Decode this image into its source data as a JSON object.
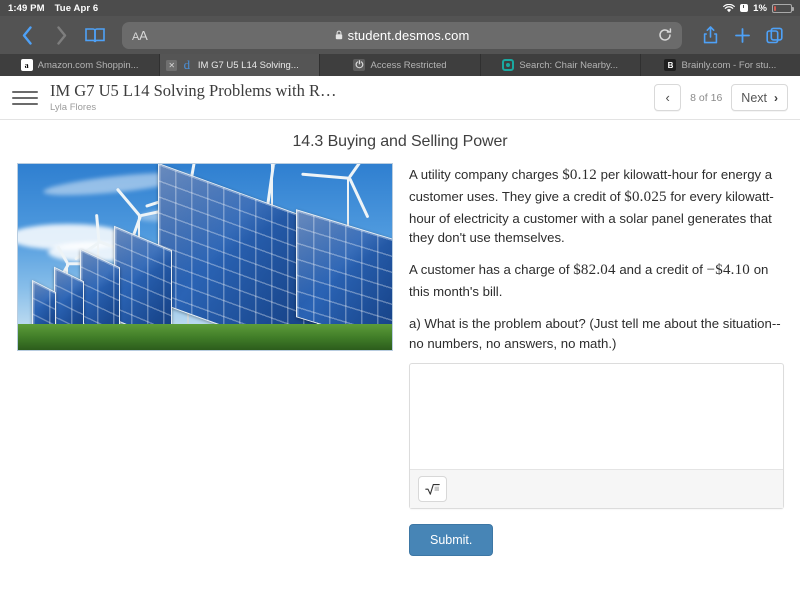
{
  "status_bar": {
    "time": "1:49 PM",
    "date": "Tue Apr 6",
    "battery_percent": "1%",
    "icons": [
      "wifi-icon",
      "alarm-icon",
      "battery-icon"
    ]
  },
  "browser": {
    "back_icon": "chevron-left-icon",
    "forward_icon": "chevron-right-icon",
    "bookmarks_icon": "book-icon",
    "text_size_label": "AA",
    "lock_icon": "lock-icon",
    "url": "student.desmos.com",
    "reload_icon": "reload-icon",
    "share_icon": "share-icon",
    "new_tab_icon": "plus-icon",
    "tabs_icon": "tabs-icon",
    "tabs": [
      {
        "label": "Amazon.com Shoppin...",
        "favicon": "amazon-favicon",
        "active": false
      },
      {
        "label": "IM G7 U5 L14 Solving...",
        "favicon": "desmos-favicon",
        "active": true,
        "close_label": "✕"
      },
      {
        "label": "Access Restricted",
        "favicon": "power-favicon",
        "active": false
      },
      {
        "label": "Search: Chair Nearby...",
        "favicon": "search-favicon",
        "active": false
      },
      {
        "label": "Brainly.com - For stu...",
        "favicon": "brainly-favicon",
        "active": false
      }
    ]
  },
  "activity_header": {
    "menu_icon": "hamburger-icon",
    "title": "IM G7 U5 L14 Solving Problems with R…",
    "student_name": "Lyla Flores",
    "prev_icon": "‹",
    "page_count": "8 of 16",
    "next_label": "Next",
    "next_icon": "›"
  },
  "screen": {
    "title": "14.3 Buying and Selling Power",
    "image_alt": "solar-panel-array-photo",
    "paragraph1_part1": "A utility company charges",
    "rate_charge": "$0.12",
    "paragraph1_part2": "per kilowatt-hour for energy a customer uses. They give a credit of",
    "rate_credit": "$0.025",
    "paragraph1_part3": "for every kilowatt-hour of electricity a customer with a solar panel generates that they don't use themselves.",
    "paragraph2_part1": "A customer has a charge of",
    "charge_amount": "$82.04",
    "paragraph2_part2": "and a credit of",
    "credit_amount": "−$4.10",
    "paragraph2_part3": "on this month's bill.",
    "question": "a) What is the problem about? (Just tell me about the situation-- no numbers, no answers, no math.)",
    "answer_value": "",
    "answer_placeholder": "",
    "math_button_icon": "square-root-icon",
    "submit_label": "Submit."
  },
  "colors": {
    "submit_blue": "#4785b6",
    "safari_chrome": "#535353",
    "status_bar": "#4c4c4c",
    "tab_strip": "#3e3e3e",
    "ios_blue": "#4ea1f7"
  }
}
